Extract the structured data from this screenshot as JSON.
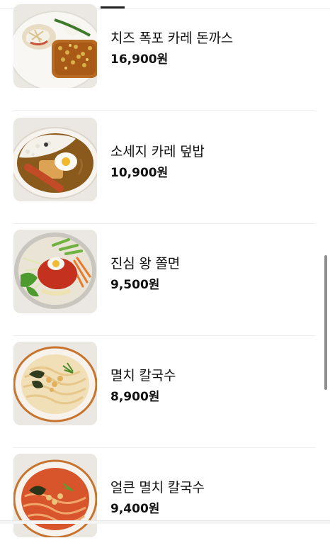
{
  "menu": {
    "items": [
      {
        "name": "치즈 폭포 카레 돈까스",
        "price": "16,900원",
        "image": "cheese-curry-tonkatsu-photo"
      },
      {
        "name": "소세지 카레 덮밥",
        "price": "10,900원",
        "image": "sausage-curry-rice-photo"
      },
      {
        "name": "진심 왕 쫄면",
        "price": "9,500원",
        "image": "jjolmyeon-photo"
      },
      {
        "name": "멸치 칼국수",
        "price": "8,900원",
        "image": "anchovy-kalguksu-photo"
      },
      {
        "name": "얼큰 멸치 칼국수",
        "price": "9,400원",
        "image": "spicy-anchovy-kalguksu-photo"
      }
    ]
  },
  "colors": {
    "background": "#ffffff",
    "text": "#111111",
    "divider": "#efefef",
    "scrollbar": "#8f8f8f"
  }
}
